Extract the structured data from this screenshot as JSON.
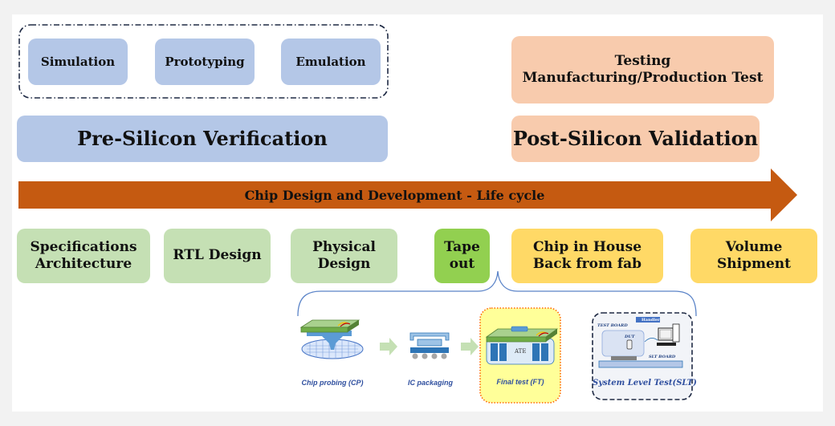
{
  "pre_silicon": {
    "methods": [
      "Simulation",
      "Prototyping",
      "Emulation"
    ],
    "title": "Pre-Silicon Verification"
  },
  "post_silicon": {
    "testing_line1": "Testing",
    "testing_line2": "Manufacturing/Production Test",
    "title": "Post-Silicon Validation"
  },
  "lifecycle_arrow": {
    "label": "Chip Design and Development -  Life cycle"
  },
  "stages": [
    {
      "line1": "Specifications",
      "line2": "Architecture"
    },
    {
      "line1": "RTL Design",
      "line2": ""
    },
    {
      "line1": "Physical",
      "line2": "Design"
    },
    {
      "line1": "Tape",
      "line2": "out"
    },
    {
      "line1": "Chip in House",
      "line2": "Back from fab"
    },
    {
      "line1": "Volume",
      "line2": "Shipment"
    }
  ],
  "test_flow": {
    "steps": [
      {
        "caption": "Chip probing (CP)",
        "icon": "wafer-probe-icon"
      },
      {
        "caption": "IC packaging",
        "icon": "ic-package-icon"
      },
      {
        "caption": "Final test (FT)",
        "icon": "ate-tester-icon",
        "inner_label": "ATE"
      },
      {
        "caption": "System Level Test(SLT)",
        "icon": "slt-setup-icon"
      }
    ],
    "slt_labels": {
      "test_board": "TEST BOARD",
      "handler": "Handler",
      "dut": "DUT",
      "slt_board": "SLT BOARD"
    }
  },
  "colors": {
    "pre_silicon": "#b4c7e7",
    "post_silicon": "#f8cbad",
    "design_stage": "#c5e0b4",
    "tapeout": "#92d050",
    "post_fab": "#ffd966",
    "arrow": "#c55a11",
    "brace": "#5b84c8"
  }
}
